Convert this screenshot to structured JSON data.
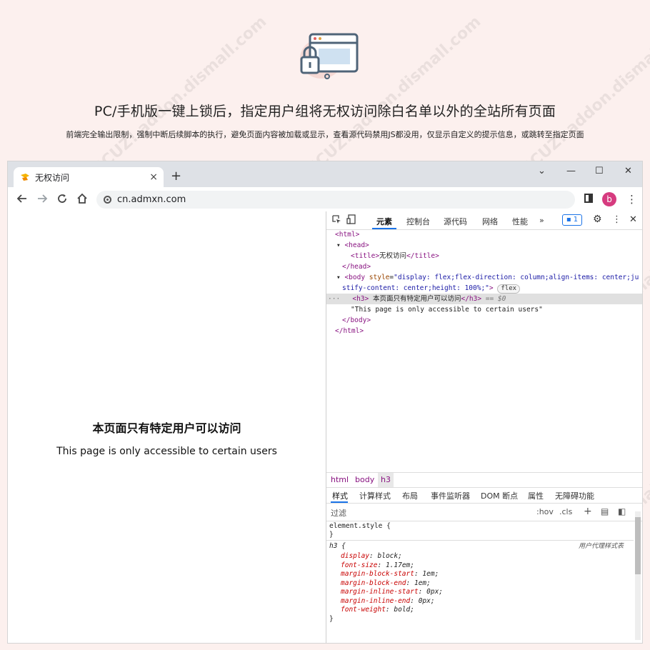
{
  "hero": {
    "title": "PC/手机版一键上锁后，指定用户组将无权访问除白名单以外的全站所有页面",
    "subtitle": "前端完全输出限制，强制中断后续脚本的执行，避免页面内容被加载或显示，查看源代码禁用JS都没用，仅显示自定义的提示信息，或跳转至指定页面"
  },
  "browser": {
    "tab_title": "无权访问",
    "tab_close": "×",
    "new_tab": "+",
    "url": "cn.admxn.com",
    "profile_initial": "b",
    "window_controls": [
      "⌄",
      "—",
      "☐",
      "✕"
    ]
  },
  "page": {
    "heading": "本页面只有特定用户可以访问",
    "text": "This page is only accessible to certain users"
  },
  "devtools": {
    "tabs": [
      "元素",
      "控制台",
      "源代码",
      "网络",
      "性能",
      "»"
    ],
    "issues_count": "1",
    "dom": {
      "html_open": "<html>",
      "head_open": "<head>",
      "title_open": "<title>",
      "title_text": "无权访问",
      "title_close": "</title>",
      "head_close": "</head>",
      "body_open_tag": "<body ",
      "body_attr": "style",
      "body_style_1": "\"display: flex;flex-direction: column;align-items: center;ju",
      "body_style_2": "stify-content: center;height: 100%;\"",
      "body_open_end": ">",
      "flex_badge": "flex",
      "row_dots": "···",
      "h3_open": "<h3>",
      "h3_text": " 本页面只有特定用户可以访问",
      "h3_close": "</h3>",
      "h3_marker": " == $0",
      "text_node": "\"This page is only accessible to certain users\"",
      "body_close": "</body>",
      "html_close": "</html>"
    },
    "breadcrumbs": [
      "html",
      "body",
      "h3"
    ],
    "style_tabs": [
      "样式",
      "计算样式",
      "布局",
      "事件监听器",
      "DOM 断点",
      "属性",
      "无障碍功能"
    ],
    "filter_label": "过滤",
    "filter_tools": [
      ":hov",
      ".cls",
      "+"
    ],
    "css": {
      "element_style": "element.style {",
      "close_brace": "}",
      "h3_selector": "h3 {",
      "user_agent_label": "用户代理样式表",
      "rules": [
        {
          "prop": "display",
          "val": "block;"
        },
        {
          "prop": "font-size",
          "val": "1.17em;"
        },
        {
          "prop": "margin-block-start",
          "val": "1em;"
        },
        {
          "prop": "margin-block-end",
          "val": "1em;"
        },
        {
          "prop": "margin-inline-start",
          "val": "0px;"
        },
        {
          "prop": "margin-inline-end",
          "val": "0px;"
        },
        {
          "prop": "font-weight",
          "val": "bold;"
        }
      ]
    }
  },
  "colors": {
    "background": "#fcf0ee",
    "accent": "#1a73e8",
    "tag": "#881280",
    "profile": "#d63b7f"
  },
  "icons": [
    "lock-browser-icon",
    "tab-favicon-icon",
    "back-arrow-icon",
    "forward-arrow-icon",
    "reload-icon",
    "home-icon",
    "site-info-icon",
    "side-panel-icon",
    "kebab-menu-icon",
    "inspect-icon",
    "device-toolbar-icon",
    "settings-gear-icon"
  ]
}
